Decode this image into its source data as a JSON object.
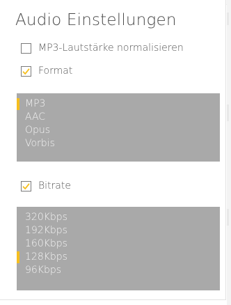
{
  "colors": {
    "accent": "#f5be1e",
    "list_background": "#a9a9a9",
    "list_text": "#f4f4f4",
    "text": "#4d4d4d"
  },
  "title": "Audio Einstellungen",
  "options": {
    "normalize": {
      "label": "MP3-Lautstärke normalisieren",
      "checked": false
    },
    "format": {
      "label": "Format",
      "checked": true
    },
    "bitrate": {
      "label": "Bitrate",
      "checked": true
    }
  },
  "format_list": {
    "items": [
      "MP3",
      "AAC",
      "Opus",
      "Vorbis"
    ],
    "selected_index": 0
  },
  "bitrate_list": {
    "items": [
      "320Kbps",
      "192Kbps",
      "160Kbps",
      "128Kbps",
      "96Kbps"
    ],
    "selected_index": 3
  }
}
